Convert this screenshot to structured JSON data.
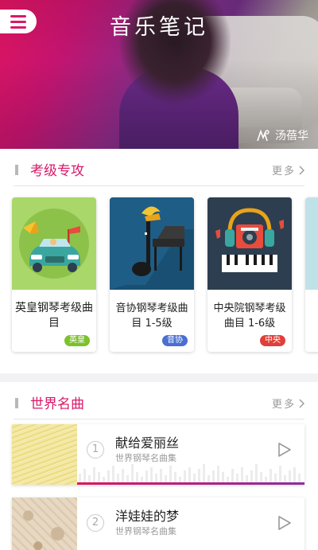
{
  "header": {
    "app_title": "音乐笔记",
    "artist_name": "汤蓓华"
  },
  "section_exam": {
    "title": "考级专攻",
    "more_label": "更多",
    "cards": [
      {
        "name": "英皇钢琴考级曲目",
        "tag": "英皇",
        "tag_color": "#7cc22a",
        "bg": "#a9d76a"
      },
      {
        "name": "音协钢琴考级曲目 1-5级",
        "tag": "音协",
        "tag_color": "#4a6fd1",
        "bg": "#1e5d86"
      },
      {
        "name": "中央院钢琴考级曲目 1-6级",
        "tag": "中央",
        "tag_color": "#e0403a",
        "bg": "#2d3e50"
      }
    ]
  },
  "section_world": {
    "title": "世界名曲",
    "more_label": "更多",
    "songs": [
      {
        "index": "1",
        "title": "献给爱丽丝",
        "subtitle": "世界钢琴名曲集"
      },
      {
        "index": "2",
        "title": "洋娃娃的梦",
        "subtitle": "世界钢琴名曲集"
      }
    ]
  },
  "colors": {
    "accent": "#d9196a",
    "hero_start": "#e0145f",
    "hero_end": "#6f2d82"
  },
  "icons": {
    "menu": "menu-icon",
    "more": "chevron-right-icon",
    "play": "play-icon",
    "artist": "artist-icon"
  }
}
